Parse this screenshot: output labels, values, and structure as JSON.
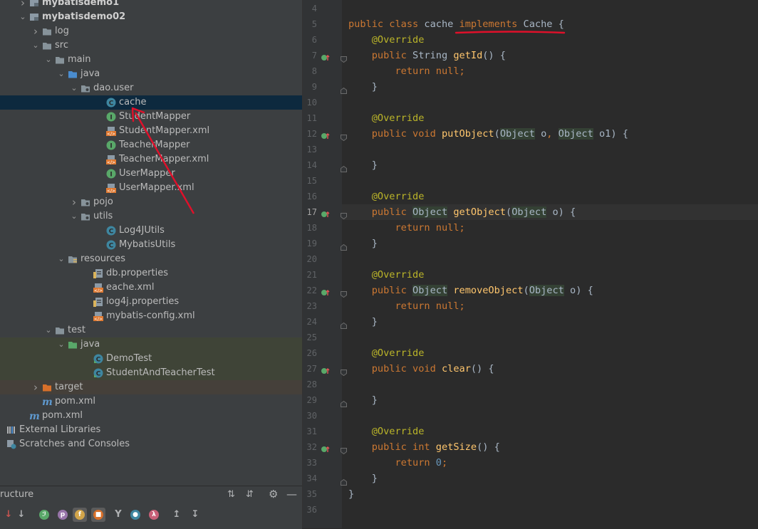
{
  "project_tree": [
    {
      "label": "mybatisdemo1",
      "bold": true,
      "arrow": "›",
      "icon": "module",
      "indent": 0
    },
    {
      "label": "mybatisdemo02",
      "bold": true,
      "arrow": "⌄",
      "icon": "module",
      "indent": 0
    },
    {
      "label": "log",
      "arrow": "›",
      "icon": "folder",
      "indent": 1
    },
    {
      "label": "src",
      "arrow": "⌄",
      "icon": "folder",
      "indent": 1
    },
    {
      "label": "main",
      "arrow": "⌄",
      "icon": "folder",
      "indent": 2
    },
    {
      "label": "java",
      "arrow": "⌄",
      "icon": "folder-blue",
      "indent": 3
    },
    {
      "label": "dao.user",
      "arrow": "⌄",
      "icon": "package",
      "indent": 4
    },
    {
      "label": "cache",
      "icon": "class",
      "indent": 6,
      "selected": true
    },
    {
      "label": "StudentMapper",
      "icon": "interface",
      "indent": 6
    },
    {
      "label": "StudentMapper.xml",
      "icon": "xml",
      "indent": 6
    },
    {
      "label": "TeacherMapper",
      "icon": "interface",
      "indent": 6
    },
    {
      "label": "TeacherMapper.xml",
      "icon": "xml",
      "indent": 6
    },
    {
      "label": "UserMapper",
      "icon": "interface",
      "indent": 6
    },
    {
      "label": "UserMapper.xml",
      "icon": "xml",
      "indent": 6
    },
    {
      "label": "pojo",
      "arrow": "›",
      "icon": "package",
      "indent": 4
    },
    {
      "label": "utils",
      "arrow": "⌄",
      "icon": "package",
      "indent": 4
    },
    {
      "label": "Log4JUtils",
      "icon": "class",
      "indent": 6
    },
    {
      "label": "MybatisUtils",
      "icon": "class",
      "indent": 6
    },
    {
      "label": "resources",
      "arrow": "⌄",
      "icon": "folder-res",
      "indent": 3
    },
    {
      "label": "db.properties",
      "icon": "props",
      "indent": 5
    },
    {
      "label": "eache.xml",
      "icon": "xml",
      "indent": 5
    },
    {
      "label": "log4j.properties",
      "icon": "props",
      "indent": 5
    },
    {
      "label": "mybatis-config.xml",
      "icon": "xml",
      "indent": 5
    },
    {
      "label": "test",
      "arrow": "⌄",
      "icon": "folder",
      "indent": 2
    },
    {
      "label": "java",
      "arrow": "⌄",
      "icon": "folder-green",
      "indent": 3,
      "bg": "green"
    },
    {
      "label": "DemoTest",
      "icon": "test-class",
      "indent": 5,
      "bg": "green"
    },
    {
      "label": "StudentAndTeacherTest",
      "icon": "test-class",
      "indent": 5,
      "bg": "green"
    },
    {
      "label": "target",
      "arrow": "›",
      "icon": "folder-orange",
      "indent": 1,
      "bg": "orange"
    },
    {
      "label": "pom.xml",
      "icon": "maven",
      "indent": 1
    },
    {
      "label": "pom.xml",
      "icon": "maven",
      "indent": 0
    },
    {
      "label": "External Libraries",
      "arrow": "›",
      "icon": "libraries",
      "indent": -1
    },
    {
      "label": "Scratches and Consoles",
      "icon": "scratches",
      "indent": -1
    }
  ],
  "editor": {
    "line_numbers": [
      "4",
      "5",
      "6",
      "7",
      "8",
      "9",
      "10",
      "11",
      "12",
      "13",
      "14",
      "15",
      "16",
      "17",
      "18",
      "19",
      "20",
      "21",
      "22",
      "23",
      "24",
      "25",
      "26",
      "27",
      "28",
      "29",
      "30",
      "31",
      "32",
      "33",
      "34",
      "35",
      "36"
    ],
    "current_line": "17",
    "code_lines": [
      [],
      [
        [
          "kw",
          "public "
        ],
        [
          "kw",
          "class "
        ],
        [
          "t",
          "cache "
        ],
        [
          "kw",
          "implements "
        ],
        [
          "t",
          "Cache {"
        ]
      ],
      [
        [
          "an",
          "    @Override"
        ]
      ],
      [
        [
          "kw",
          "    public "
        ],
        [
          "t",
          "String "
        ],
        [
          "fn",
          "getId"
        ],
        [
          "t",
          "() {"
        ]
      ],
      [
        [
          "kw",
          "        return null"
        ],
        [
          "kw",
          ";"
        ]
      ],
      [
        [
          "t",
          "    }"
        ]
      ],
      [],
      [
        [
          "an",
          "    @Override"
        ]
      ],
      [
        [
          "kw",
          "    public void "
        ],
        [
          "fn",
          "putObject"
        ],
        [
          "t",
          "("
        ],
        [
          "hl",
          "Object"
        ],
        [
          "t",
          " o"
        ],
        [
          "kw",
          ", "
        ],
        [
          "hl",
          "Object"
        ],
        [
          "t",
          " o1) {"
        ]
      ],
      [],
      [
        [
          "t",
          "    }"
        ]
      ],
      [],
      [
        [
          "an",
          "    @Override"
        ]
      ],
      [
        [
          "kw",
          "    public "
        ],
        [
          "hl",
          "Object"
        ],
        [
          "t",
          " "
        ],
        [
          "fn",
          "getObject"
        ],
        [
          "t",
          "("
        ],
        [
          "hl",
          "Object"
        ],
        [
          "t",
          " o) {"
        ]
      ],
      [
        [
          "kw",
          "        return null"
        ],
        [
          "kw",
          ";"
        ]
      ],
      [
        [
          "t",
          "    }"
        ]
      ],
      [],
      [
        [
          "an",
          "    @Override"
        ]
      ],
      [
        [
          "kw",
          "    public "
        ],
        [
          "hl",
          "Object"
        ],
        [
          "t",
          " "
        ],
        [
          "fn",
          "removeObject"
        ],
        [
          "t",
          "("
        ],
        [
          "hl",
          "Object"
        ],
        [
          "t",
          " o) {"
        ]
      ],
      [
        [
          "kw",
          "        return null"
        ],
        [
          "kw",
          ";"
        ]
      ],
      [
        [
          "t",
          "    }"
        ]
      ],
      [],
      [
        [
          "an",
          "    @Override"
        ]
      ],
      [
        [
          "kw",
          "    public void "
        ],
        [
          "fn",
          "clear"
        ],
        [
          "t",
          "() {"
        ]
      ],
      [],
      [
        [
          "t",
          "    }"
        ]
      ],
      [],
      [
        [
          "an",
          "    @Override"
        ]
      ],
      [
        [
          "kw",
          "    public int "
        ],
        [
          "fn",
          "getSize"
        ],
        [
          "t",
          "() {"
        ]
      ],
      [
        [
          "kw",
          "        return "
        ],
        [
          "nm",
          "0"
        ],
        [
          "kw",
          ";"
        ]
      ],
      [
        [
          "t",
          "    }"
        ]
      ],
      [
        [
          "t",
          "}"
        ]
      ],
      []
    ],
    "override_marker_lines": [
      "7",
      "12",
      "17",
      "22",
      "27",
      "32"
    ]
  },
  "structure_panel": {
    "title": "ructure",
    "toolbar_icons": [
      "expand-all-icon",
      "collapse-all-icon",
      "gear-icon",
      "minimize-icon"
    ],
    "filter_icons": [
      "sort-visibility-icon",
      "sort-alpha-icon",
      "show-inherited-icon",
      "show-properties-icon",
      "show-fields-icon",
      "show-non-public-icon",
      "show-methods-icon",
      "show-anonymous-icon",
      "show-lambdas-icon",
      "navigate-up-icon",
      "navigate-down-icon"
    ]
  },
  "colors": {
    "keyword": "#cc7832",
    "method": "#ffc66d",
    "annotation": "#bbb529",
    "number": "#6897bb",
    "annotation_red": "#e0102a"
  }
}
